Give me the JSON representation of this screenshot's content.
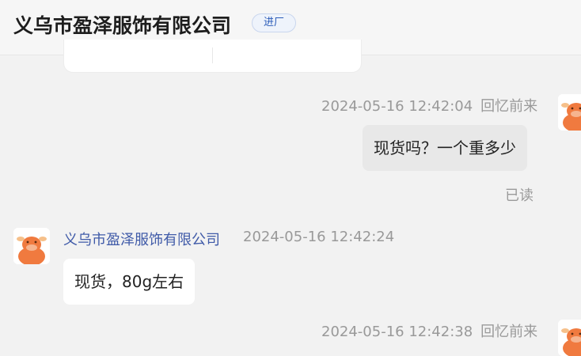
{
  "header": {
    "title": "义乌市盈泽服饰有限公司",
    "badge": "进厂"
  },
  "messages": [
    {
      "timestamp": "2024-05-16 12:42:04",
      "status": "回忆前来",
      "text": "现货吗？一个重多少",
      "read": "已读"
    },
    {
      "sender": "义乌市盈泽服饰有限公司",
      "timestamp": "2024-05-16 12:42:24",
      "text": "现货，80g左右"
    },
    {
      "timestamp": "2024-05-16 12:42:38",
      "status": "回忆前来"
    }
  ],
  "colors": {
    "background": "#f2f2f2",
    "sent_bubble": "#e8e8e8",
    "received_bubble": "#ffffff",
    "sender_name": "#3f5aa8",
    "badge_text": "#2a5bb8",
    "avatar_orange": "#f07a3f"
  },
  "icons": {
    "avatar": "orange-cow-avatar-icon"
  }
}
